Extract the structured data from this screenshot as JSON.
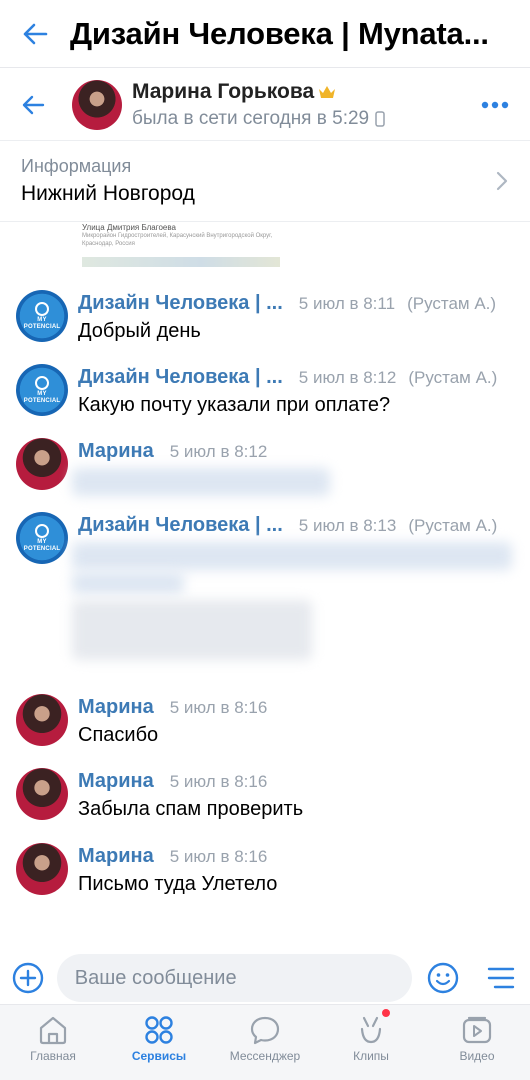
{
  "topbar": {
    "title": "Дизайн Человека | Mynata..."
  },
  "chat_header": {
    "name": "Марина Горькова",
    "status": "была в сети сегодня в 5:29"
  },
  "info": {
    "label": "Информация",
    "value": "Нижний Новгород"
  },
  "map_snippet": {
    "line1": "Улица Дмитрия Благоева",
    "line2": "Микрорайон Гидростроителей, Карасунский Внутригородской Округ, Краснодар, Россия"
  },
  "messages": [
    {
      "sender": "Дизайн Человека | ...",
      "time": "5 июл в 8:11",
      "by": "(Рустам А.)",
      "text": "Добрый день"
    },
    {
      "sender": "Дизайн Человека | ...",
      "time": "5 июл в 8:12",
      "by": "(Рустам А.)",
      "text": "Какую почту указали при оплате?"
    },
    {
      "sender": "Марина",
      "time": "5 июл в 8:12",
      "by": "",
      "text": ""
    },
    {
      "sender": "Дизайн Человека | ...",
      "time": "5 июл в 8:13",
      "by": "(Рустам А.)",
      "text": ""
    },
    {
      "sender": "Марина",
      "time": "5 июл в 8:16",
      "by": "",
      "text": "Спасибо"
    },
    {
      "sender": "Марина",
      "time": "5 июл в 8:16",
      "by": "",
      "text": "Забыла спам проверить"
    },
    {
      "sender": "Марина",
      "time": "5 июл в 8:16",
      "by": "",
      "text": "Письмо туда Улетело"
    }
  ],
  "composer": {
    "placeholder": "Ваше сообщение"
  },
  "tabs": [
    {
      "label": "Главная",
      "icon": "home-icon",
      "active": false
    },
    {
      "label": "Сервисы",
      "icon": "services-icon",
      "active": true
    },
    {
      "label": "Мессенджер",
      "icon": "messenger-icon",
      "active": false
    },
    {
      "label": "Клипы",
      "icon": "clips-icon",
      "active": false
    },
    {
      "label": "Видео",
      "icon": "video-icon",
      "active": false
    }
  ],
  "colors": {
    "accent": "#2d81e0",
    "sender": "#2a5885",
    "muted": "#818c99",
    "badge": "#ff3347"
  }
}
